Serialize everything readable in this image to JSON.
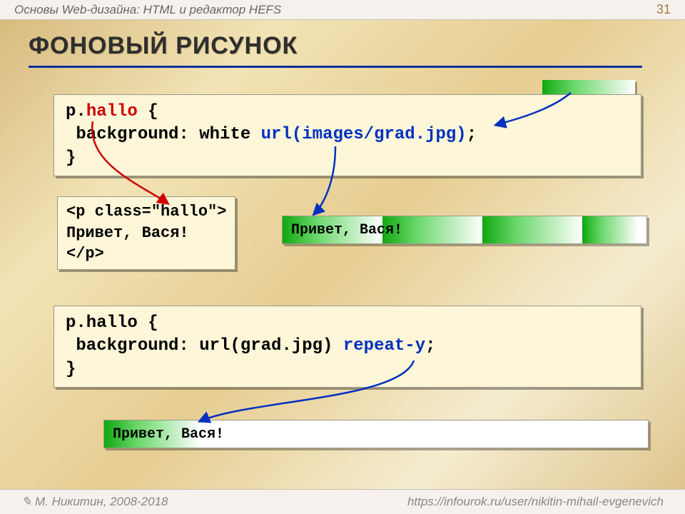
{
  "header": {
    "title": "Основы Web-дизайна: HTML и редактор HEFS",
    "page": "31"
  },
  "title": "ФОНОВЫЙ РИСУНОК",
  "code1": {
    "pre1": "p.",
    "hallo": "hallo",
    "post1": " {",
    "pre2": " background: white ",
    "url": "url(images/grad.jpg)",
    "post2": ";",
    "close": "}"
  },
  "code_html": {
    "pre": "<p class=\"",
    "cls": "hallo",
    "post": "\">",
    "body": "Привет, Вася!",
    "close": "</p>"
  },
  "result1": {
    "text": "Привет, Вася!"
  },
  "code2": {
    "line1": "p.hallo {",
    "pre2": " background: url(grad.jpg) ",
    "repeat": "repeat-y",
    "post2": ";",
    "close": "}"
  },
  "result2": {
    "text": "Привет, Вася!"
  },
  "footer": {
    "left": "М. Никитин, 2008-2018",
    "right": "https://infourok.ru/user/nikitin-mihail-evgenevich"
  }
}
